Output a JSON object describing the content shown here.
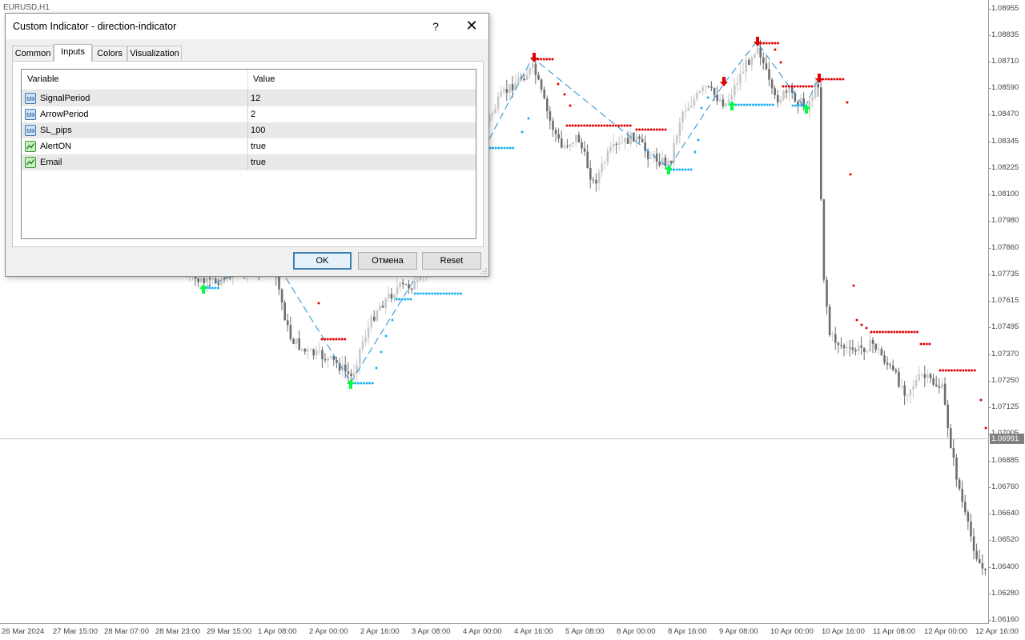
{
  "chart": {
    "symbol": "EURUSD,H1",
    "current_price": "1.06991",
    "price_ticks": [
      "1.08955",
      "1.08835",
      "1.08710",
      "1.08590",
      "1.08470",
      "1.08345",
      "1.08225",
      "1.08100",
      "1.07980",
      "1.07860",
      "1.07735",
      "1.07615",
      "1.07495",
      "1.07370",
      "1.07250",
      "1.07125",
      "1.07005",
      "1.06885",
      "1.06760",
      "1.06640",
      "1.06520",
      "1.06400",
      "1.06280",
      "1.06160"
    ],
    "time_ticks": [
      "26 Mar 2024",
      "27 Mar 15:00",
      "28 Mar 07:00",
      "28 Mar 23:00",
      "29 Mar 15:00",
      "1 Apr 08:00",
      "2 Apr 00:00",
      "2 Apr 16:00",
      "3 Apr 08:00",
      "4 Apr 00:00",
      "4 Apr 16:00",
      "5 Apr 08:00",
      "8 Apr 00:00",
      "8 Apr 16:00",
      "9 Apr 08:00",
      "10 Apr 00:00",
      "10 Apr 16:00",
      "11 Apr 08:00",
      "12 Apr 00:00",
      "12 Apr 16:00"
    ],
    "colors": {
      "bull_candle": "#c8c8c8",
      "bear_candle": "#6e6e6e",
      "buy_arrow": "#00ff40",
      "sell_arrow": "#e00000",
      "support_dots": "#1ab0f0",
      "resistance_dots": "#e00000",
      "signal_line": "#1e90d0",
      "current_line": "#c8c8c8"
    }
  },
  "dialog": {
    "title": "Custom Indicator - direction-indicator",
    "help_label": "?",
    "close_label": "✕",
    "tabs": [
      {
        "label": "Common"
      },
      {
        "label": "Inputs"
      },
      {
        "label": "Colors"
      },
      {
        "label": "Visualization"
      }
    ],
    "active_tab": "Inputs",
    "grid": {
      "headers": {
        "variable": "Variable",
        "value": "Value"
      },
      "rows": [
        {
          "name": "SignalPeriod",
          "value": "12",
          "icon": "numeric-icon"
        },
        {
          "name": "ArrowPeriod",
          "value": "2",
          "icon": "numeric-icon"
        },
        {
          "name": "SL_pips",
          "value": "100",
          "icon": "numeric-icon"
        },
        {
          "name": "AlertON",
          "value": "true",
          "icon": "boolean-icon"
        },
        {
          "name": "Email",
          "value": "true",
          "icon": "boolean-icon"
        }
      ]
    },
    "buttons": {
      "ok": "OK",
      "cancel": "Отмена",
      "reset": "Reset"
    }
  }
}
